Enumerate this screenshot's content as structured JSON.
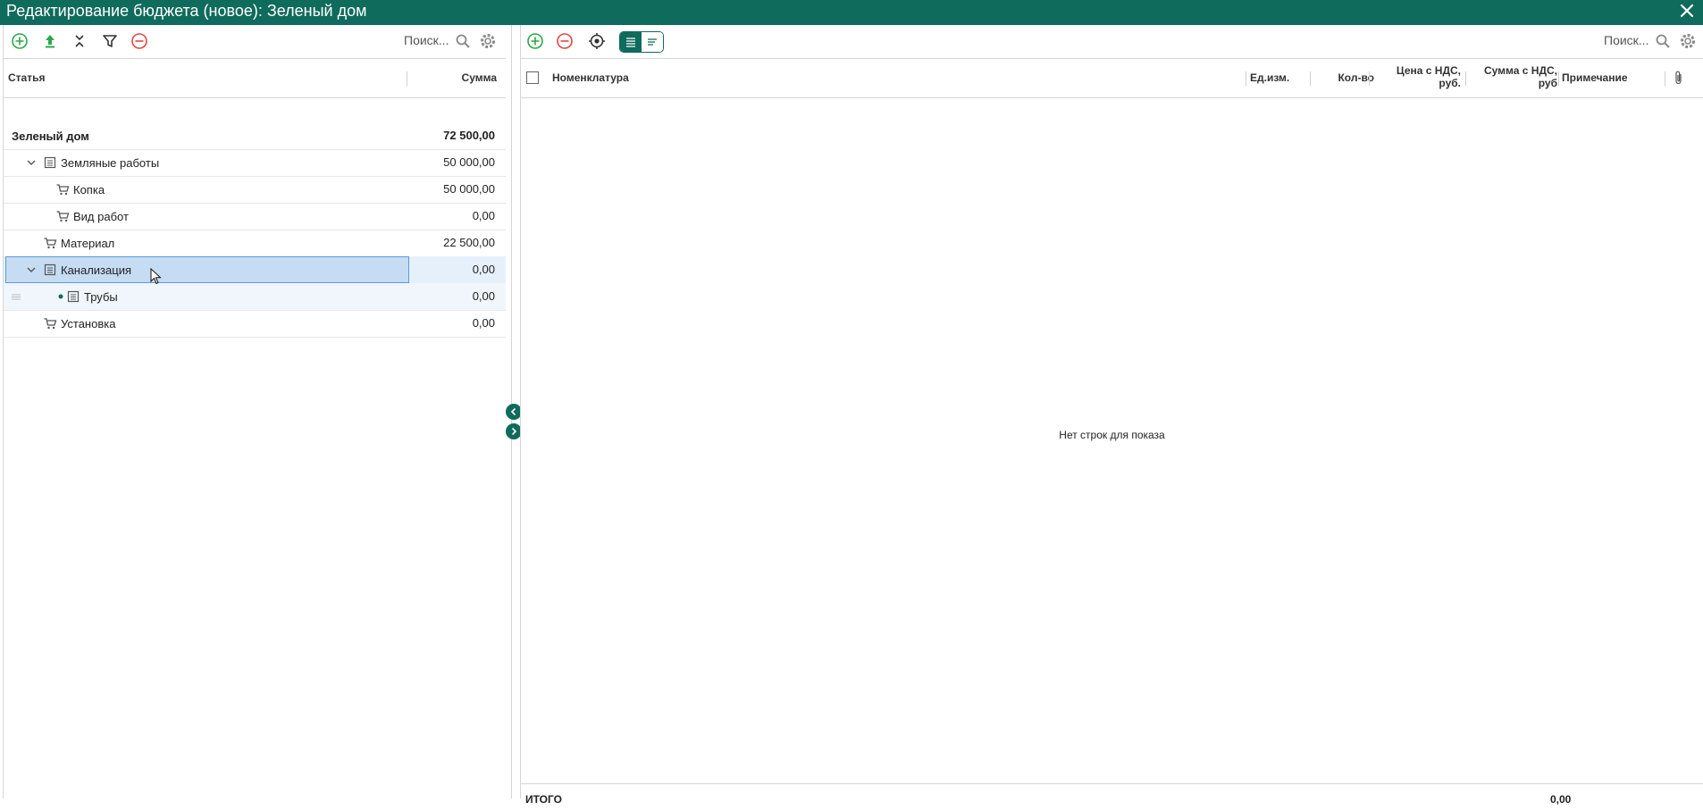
{
  "window": {
    "title": "Редактирование бюджета (новое): Зеленый дом"
  },
  "left": {
    "search_placeholder": "Поиск...",
    "columns": {
      "article": "Статья",
      "sum": "Сумма"
    },
    "rows": [
      {
        "label": "Зеленый дом",
        "sum": "72 500,00"
      },
      {
        "label": "Земляные работы",
        "sum": "50 000,00"
      },
      {
        "label": "Копка",
        "sum": "50 000,00"
      },
      {
        "label": "Вид работ",
        "sum": "0,00"
      },
      {
        "label": "Материал",
        "sum": "22 500,00"
      },
      {
        "label": "Канализация",
        "sum": "0,00"
      },
      {
        "label": "Трубы",
        "sum": "0,00"
      },
      {
        "label": "Установка",
        "sum": "0,00"
      }
    ]
  },
  "right": {
    "search_placeholder": "Поиск...",
    "columns": {
      "nomenclature": "Номенклатура",
      "unit": "Ед.изм.",
      "qty": "Кол-во",
      "price_l1": "Цена с НДС,",
      "price_l2": "руб.",
      "sum_l1": "Сумма с НДС,",
      "sum_l2": "руб",
      "note": "Примечание"
    },
    "empty_message": "Нет строк для показа",
    "footer": {
      "total_label": "ИТОГО",
      "total_value": "0,00"
    }
  },
  "colors": {
    "brand": "#0f6b5b",
    "add": "#2aa84a",
    "remove": "#e04646",
    "selection": "#c5dcf3"
  }
}
